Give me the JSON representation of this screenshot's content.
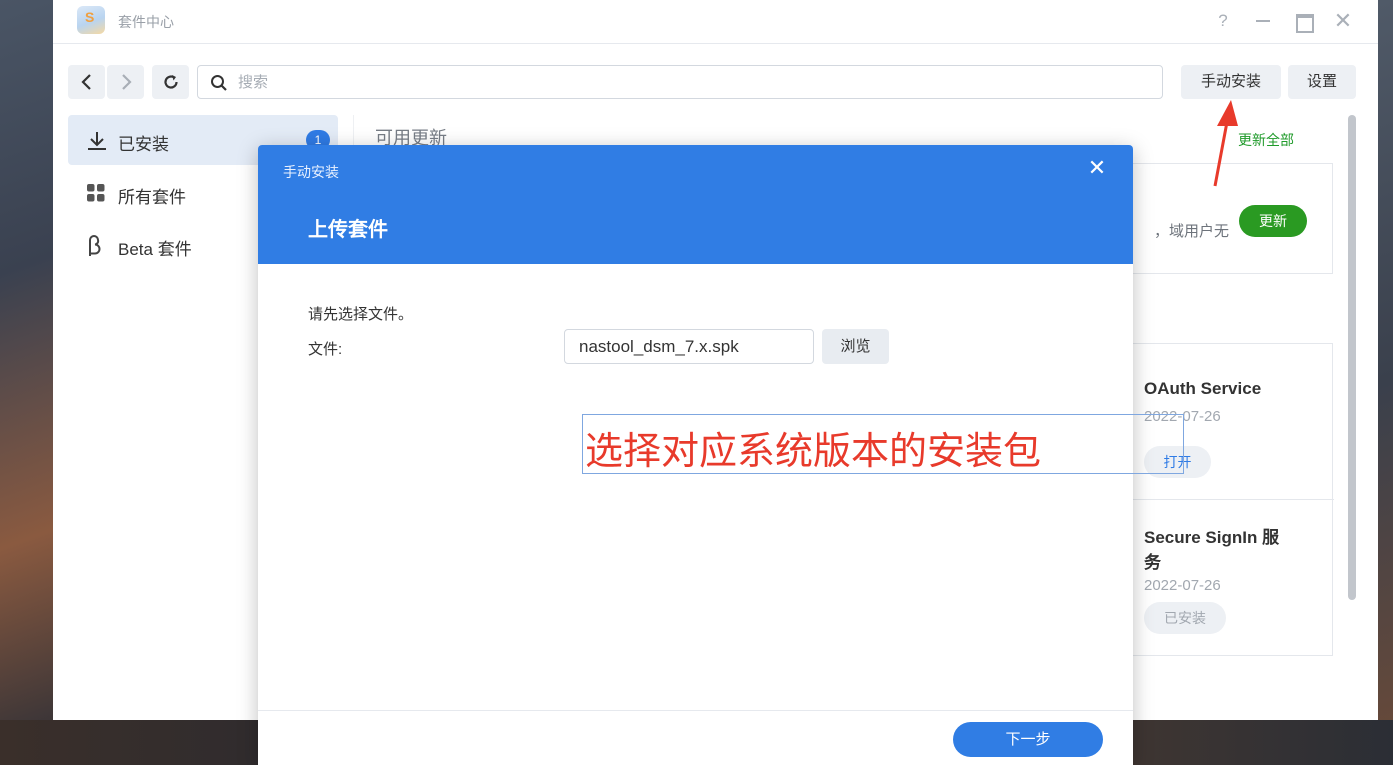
{
  "window": {
    "title": "套件中心",
    "controls": {
      "help": "?",
      "close": "✕"
    }
  },
  "toolbar": {
    "search_placeholder": "搜索",
    "manual_install_label": "手动安装",
    "settings_label": "设置"
  },
  "sidebar": {
    "items": [
      {
        "label": "已安装",
        "icon": "download-icon",
        "badge": "1",
        "active": true
      },
      {
        "label": "所有套件",
        "icon": "grid-icon",
        "active": false
      },
      {
        "label": "Beta 套件",
        "icon": "beta-icon",
        "active": false
      }
    ]
  },
  "main": {
    "section_title": "可用更新",
    "update_all_label": "更新全部",
    "update_card": {
      "description_fragment": "，域用户无",
      "update_label": "更新"
    },
    "installed_packages": [
      {
        "name": "OAuth Service",
        "date": "2022-07-26",
        "action": "打开"
      },
      {
        "name": "Secure SignIn 服务",
        "name_line1": "Secure SignIn 服",
        "name_line2": "务",
        "date": "2022-07-26",
        "action": "已安装"
      }
    ]
  },
  "dialog": {
    "title": "手动安装",
    "close": "✕",
    "step_title": "上传套件",
    "hint": "请先选择文件。",
    "file_label": "文件:",
    "file_value": "nastool_dsm_7.x.spk",
    "browse_label": "浏览",
    "next_label": "下一步"
  },
  "annotation": {
    "text": "选择对应系统版本的安装包",
    "color": "#e83a2b"
  },
  "colors": {
    "accent": "#307de4",
    "update_green": "#2a9a22",
    "badge_blue": "#2f7be5"
  }
}
